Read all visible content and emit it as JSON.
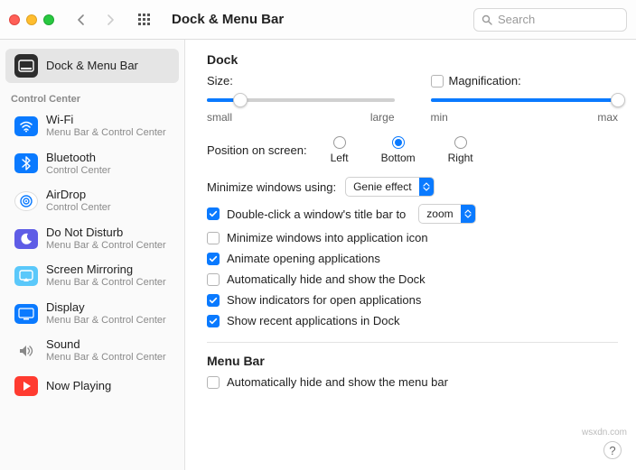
{
  "toolbar": {
    "title": "Dock & Menu Bar",
    "search_placeholder": "Search"
  },
  "sidebar": {
    "primary": {
      "label": "Dock & Menu Bar"
    },
    "section_label": "Control Center",
    "items": [
      {
        "label": "Wi-Fi",
        "sub": "Menu Bar & Control Center"
      },
      {
        "label": "Bluetooth",
        "sub": "Control Center"
      },
      {
        "label": "AirDrop",
        "sub": "Control Center"
      },
      {
        "label": "Do Not Disturb",
        "sub": "Menu Bar & Control Center"
      },
      {
        "label": "Screen Mirroring",
        "sub": "Menu Bar & Control Center"
      },
      {
        "label": "Display",
        "sub": "Menu Bar & Control Center"
      },
      {
        "label": "Sound",
        "sub": "Menu Bar & Control Center"
      },
      {
        "label": "Now Playing",
        "sub": ""
      }
    ]
  },
  "main": {
    "dock": {
      "heading": "Dock",
      "size": {
        "label": "Size:",
        "min_label": "small",
        "max_label": "large",
        "value_pct": 18
      },
      "magnification": {
        "label": "Magnification:",
        "checked": false,
        "min_label": "min",
        "max_label": "max",
        "value_pct": 100
      },
      "position": {
        "label": "Position on screen:",
        "options": [
          "Left",
          "Bottom",
          "Right"
        ],
        "selected": "Bottom"
      },
      "minimize_using": {
        "label": "Minimize windows using:",
        "value": "Genie effect"
      },
      "checks": [
        {
          "label_pre": "Double-click a window's title bar to",
          "select": "zoom",
          "checked": true
        },
        {
          "label": "Minimize windows into application icon",
          "checked": false
        },
        {
          "label": "Animate opening applications",
          "checked": true
        },
        {
          "label": "Automatically hide and show the Dock",
          "checked": false
        },
        {
          "label": "Show indicators for open applications",
          "checked": true
        },
        {
          "label": "Show recent applications in Dock",
          "checked": true
        }
      ]
    },
    "menubar": {
      "heading": "Menu Bar",
      "auto_hide": {
        "label": "Automatically hide and show the menu bar",
        "checked": false
      }
    }
  },
  "watermark": "wsxdn.com"
}
